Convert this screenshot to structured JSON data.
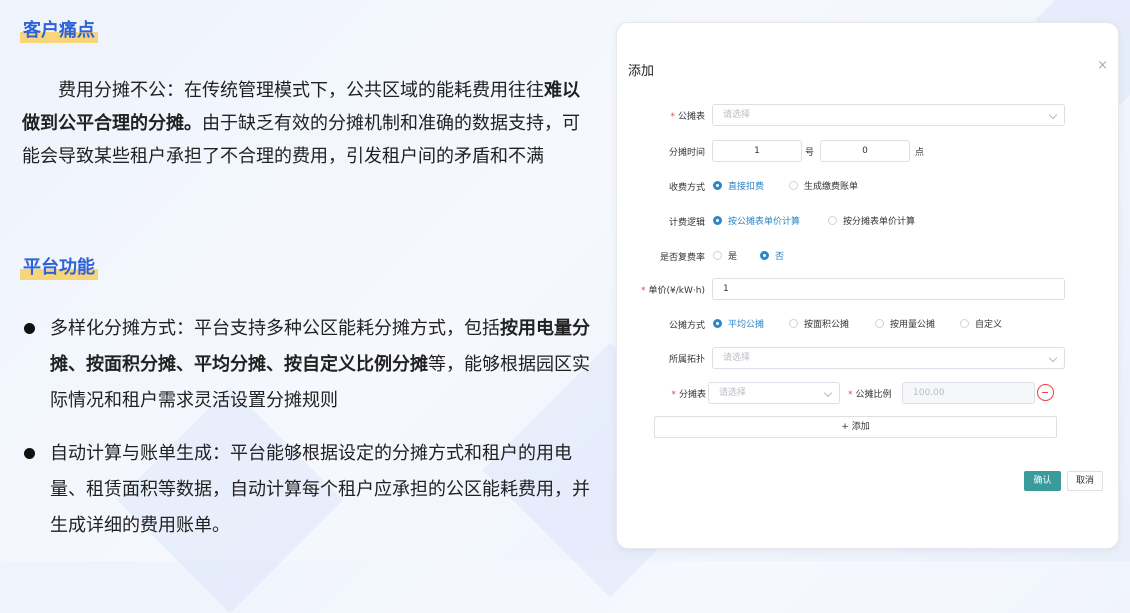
{
  "left": {
    "heading1": "客户痛点",
    "para1": {
      "indent": "　　",
      "a": "费用分摊不公：在传统管理模式下，公共区域的能耗费用往往",
      "b": "难以做到公平合理的分摊。",
      "c": "由于缺乏有效的分摊机制和准确的数据支持，可能会导致某些租户承担了不合理的费用，引发租户间的矛盾和不满"
    },
    "heading2": "平台功能",
    "bullet1": {
      "a": "多样化分摊方式：平台支持多种公区能耗分摊方式，包括",
      "b": "按用电量分摊、按面积分摊、平均分摊、按自定义比例分摊",
      "c": "等，能够根据园区实际情况和租户需求灵活设置分摊规则"
    },
    "bullet2": {
      "a": "自动计算与账单生成：平台能够根据设定的分摊方式和租户的用电量、租赁面积等数据，自动计算每个租户应承担的公区能耗费用，并生成详细的费用账单。"
    }
  },
  "dialog": {
    "title": "添加",
    "close": "×",
    "required_mark": "*",
    "table_label": "公摊表",
    "table_placeholder": "请选择",
    "time_label": "分摊时间",
    "time_day": "1",
    "time_day_unit": "号",
    "time_hour": "0",
    "time_hour_unit": "点",
    "charge_label": "收费方式",
    "charge_opt1": "直接扣费",
    "charge_opt2": "生成缴费账单",
    "logic_label": "计费逻辑",
    "logic_opt1": "按公摊表单价计算",
    "logic_opt2": "按分摊表单价计算",
    "complex_label": "是否复费率",
    "complex_opt1": "是",
    "complex_opt2": "否",
    "price_label": "单价(¥/kW·h)",
    "price_value": "1",
    "method_label": "公摊方式",
    "method_opt1": "平均公摊",
    "method_opt2": "按面积公摊",
    "method_opt3": "按用量公摊",
    "method_opt4": "自定义",
    "topo_label": "所属拓扑",
    "topo_placeholder": "请选择",
    "split_label": "分摊表",
    "split_placeholder": "请选择",
    "ratio_label": "公摊比例",
    "ratio_placeholder": "100.00",
    "add_row": "+ 添加",
    "confirm": "确认",
    "cancel": "取消"
  }
}
